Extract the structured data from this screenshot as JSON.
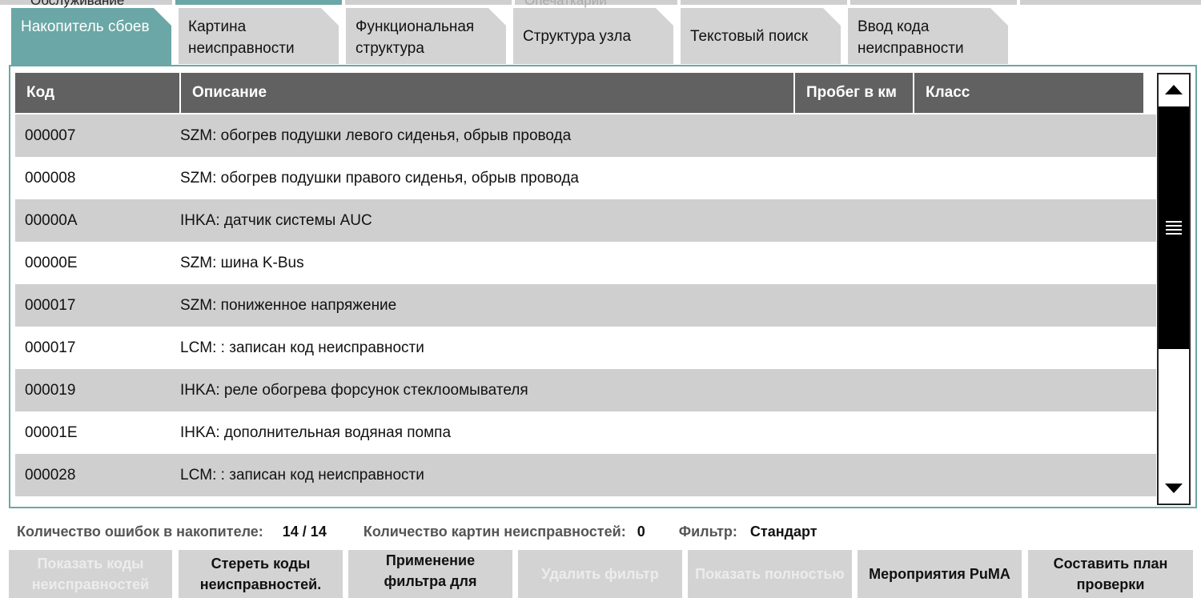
{
  "top_tabs": [
    {
      "label": "Обслуживание",
      "active": false
    },
    {
      "label": "",
      "active": true
    },
    {
      "label": "",
      "active": false
    },
    {
      "label": "Опечаткарий",
      "active": false
    },
    {
      "label": "",
      "active": false
    },
    {
      "label": "",
      "active": false
    },
    {
      "label": "",
      "active": false
    }
  ],
  "tabs": [
    {
      "label": "Накопитель сбоев",
      "active": true
    },
    {
      "label": "Картина неисправности",
      "active": false
    },
    {
      "label": "Функциональная структура",
      "active": false
    },
    {
      "label": "Структура узла",
      "active": false
    },
    {
      "label": "Текстовый поиск",
      "active": false
    },
    {
      "label": "Ввод кода неисправности",
      "active": false
    }
  ],
  "table": {
    "headers": [
      "Код",
      "Описание",
      "Пробег в км",
      "Класс"
    ],
    "rows": [
      {
        "code": "000007",
        "desc": "SZM: обогрев подушки левого сиденья, обрыв провода"
      },
      {
        "code": "000008",
        "desc": "SZM: обогрев подушки правого сиденья, обрыв провода"
      },
      {
        "code": "00000A",
        "desc": "IHKA: датчик системы AUC"
      },
      {
        "code": "00000E",
        "desc": "SZM: шина K-Bus"
      },
      {
        "code": "000017",
        "desc": "SZM: пониженное напряжение"
      },
      {
        "code": "000017",
        "desc": "LCM: : записан код неисправности"
      },
      {
        "code": "000019",
        "desc": "IHKA: реле обогрева форсунок стеклоомывателя"
      },
      {
        "code": "00001E",
        "desc": "IHKA: дополнительная водяная помпа"
      },
      {
        "code": "000028",
        "desc": "LCM: : записан код неисправности"
      }
    ]
  },
  "scrollbar": {
    "thumb_fraction": 0.65
  },
  "status": {
    "errors_label": "Количество ошибок в накопителе:",
    "errors_value": "14 / 14",
    "images_label": "Количество картин неисправностей:",
    "images_value": "0",
    "filter_label": "Фильтр:",
    "filter_value": "Стандарт"
  },
  "buttons": [
    {
      "label": "Показать коды неисправностей",
      "enabled": false
    },
    {
      "label": "Стереть коды неисправностей.",
      "enabled": true
    },
    {
      "label": "Применение фильтра для",
      "enabled": true
    },
    {
      "label": "Удалить фильтр",
      "enabled": false
    },
    {
      "label": "Показать полностью",
      "enabled": false
    },
    {
      "label": "Мероприятия PuMA",
      "enabled": true
    },
    {
      "label": "Составить план проверки",
      "enabled": true
    }
  ],
  "colors": {
    "accent": "#6aa7a6",
    "header": "#616161",
    "row_alt": "#cfcfcf",
    "button": "#d3d3d3"
  }
}
